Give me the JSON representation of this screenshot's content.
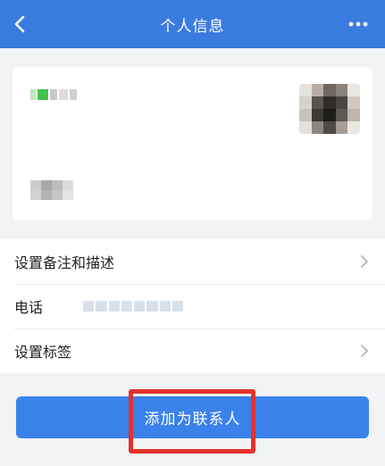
{
  "header": {
    "title": "个人信息",
    "back_icon": "chevron-left-icon",
    "more_icon": "more-horizontal-icon"
  },
  "list": {
    "items": [
      {
        "label": "设置备注和描述",
        "has_chevron": true
      },
      {
        "label": "电话",
        "has_chevron": false
      },
      {
        "label": "设置标签",
        "has_chevron": true
      }
    ]
  },
  "action": {
    "add_contact_label": "添加为联系人"
  },
  "colors": {
    "header_bg": "#3a7be0",
    "button_bg": "#3a82ea",
    "highlight": "#e5322d",
    "page_bg": "#f2f3f5"
  }
}
